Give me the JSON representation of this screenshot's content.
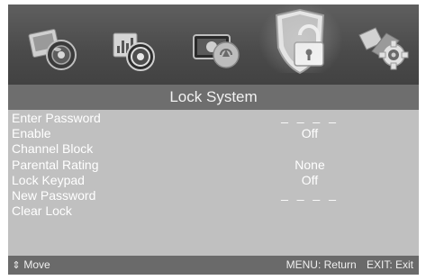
{
  "menu_title": "Lock System",
  "tabs": [
    {
      "icon": "picture-menu-icon",
      "active": false
    },
    {
      "icon": "sound-menu-icon",
      "active": false
    },
    {
      "icon": "channel-menu-icon",
      "active": false
    },
    {
      "icon": "lock-menu-icon",
      "active": true
    },
    {
      "icon": "setup-menu-icon",
      "active": false
    }
  ],
  "items": [
    {
      "label": "Enter Password",
      "value": "_ _ _ _"
    },
    {
      "label": "Enable",
      "value": "Off"
    },
    {
      "label": "Channel Block",
      "value": ""
    },
    {
      "label": "Parental Rating",
      "value": "None"
    },
    {
      "label": "Lock Keypad",
      "value": "Off"
    },
    {
      "label": "New Password",
      "value": "_ _ _ _"
    },
    {
      "label": "Clear Lock",
      "value": ""
    }
  ],
  "footer": {
    "move_label": "Move",
    "move_icon": "up-down-arrows-icon",
    "menu_hint": "MENU: Return",
    "exit_hint": "EXIT: Exit"
  },
  "colors": {
    "icon_bar": "#4a4a4a",
    "title_bar": "#6e6e6e",
    "menu_body": "#c0c0c0",
    "footer": "#6a6a6a",
    "text": "#ffffff"
  }
}
